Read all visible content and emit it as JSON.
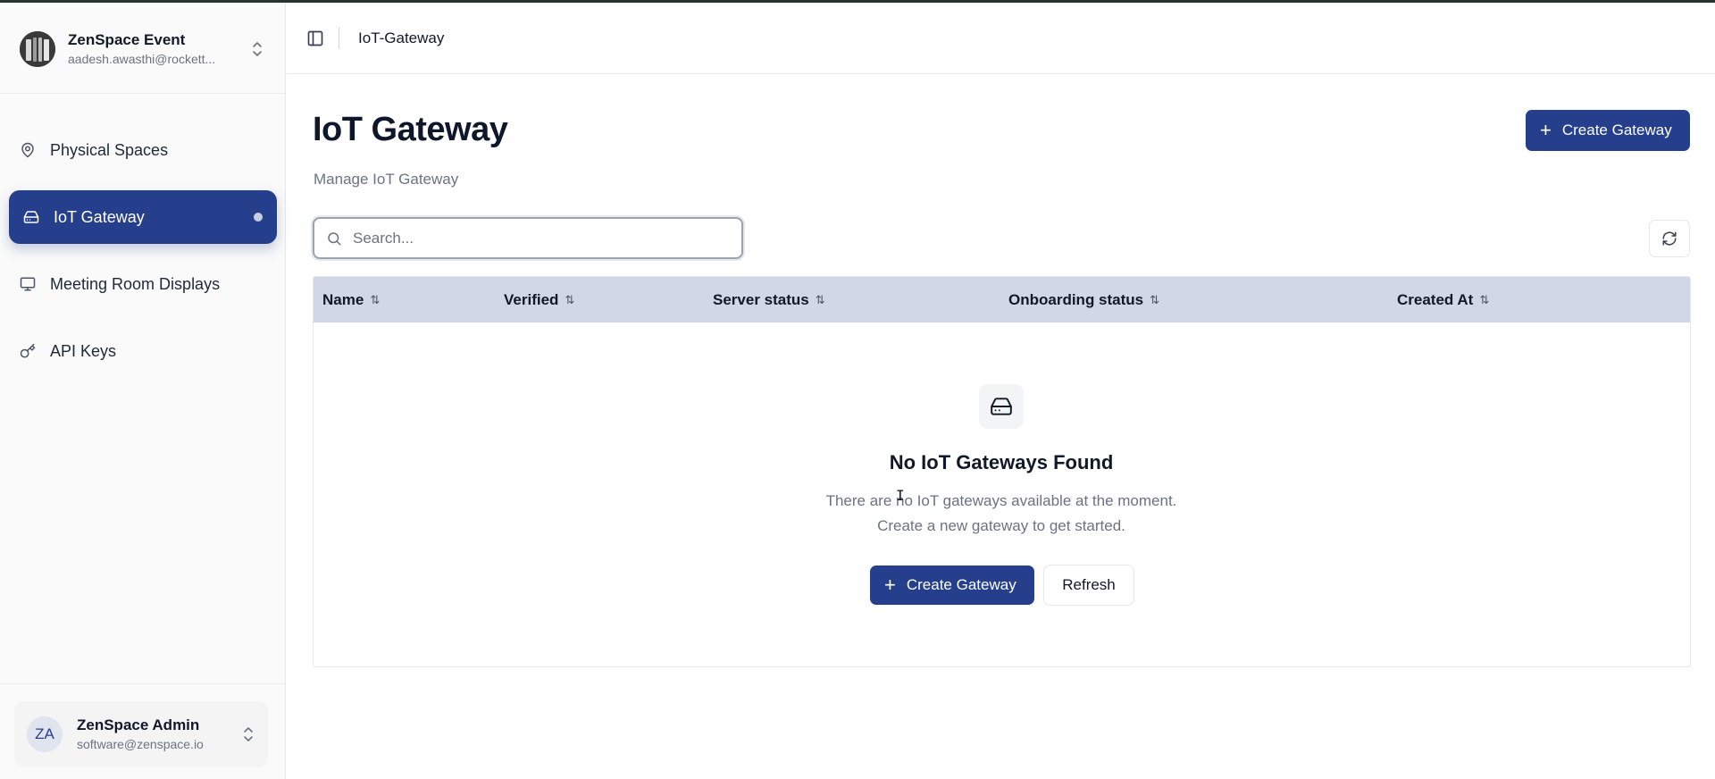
{
  "sidebar": {
    "org": {
      "name": "ZenSpace Event",
      "email": "aadesh.awasthi@rockett..."
    },
    "items": [
      {
        "label": "Physical Spaces",
        "icon": "map-pin-icon",
        "active": false
      },
      {
        "label": "IoT Gateway",
        "icon": "hard-drive-icon",
        "active": true
      },
      {
        "label": "Meeting Room Displays",
        "icon": "monitor-icon",
        "active": false
      },
      {
        "label": "API Keys",
        "icon": "key-icon",
        "active": false
      }
    ],
    "user": {
      "initials": "ZA",
      "name": "ZenSpace Admin",
      "email": "software@zenspace.io"
    }
  },
  "header": {
    "breadcrumb": "IoT-Gateway"
  },
  "main": {
    "title": "IoT Gateway",
    "subtitle": "Manage IoT Gateway",
    "create_label": "Create Gateway",
    "search": {
      "placeholder": "Search...",
      "value": ""
    },
    "table": {
      "columns": [
        "Name",
        "Verified",
        "Server status",
        "Onboarding status",
        "Created At"
      ],
      "rows": []
    },
    "empty": {
      "title": "No IoT Gateways Found",
      "description": "There are no IoT gateways available at the moment. Create a new gateway to get started.",
      "create_label": "Create Gateway",
      "refresh_label": "Refresh"
    }
  },
  "colors": {
    "accent": "#263f8c",
    "table_header": "#d2d7e8",
    "muted_text": "#6b7280"
  }
}
